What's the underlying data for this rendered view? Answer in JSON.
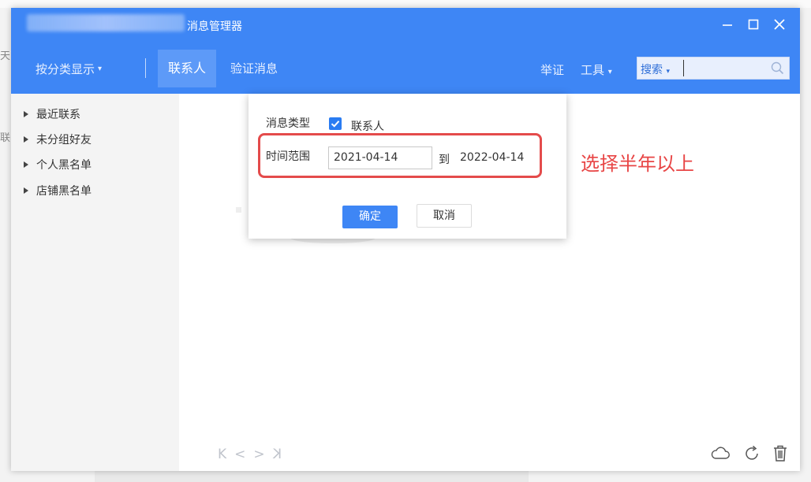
{
  "background": {
    "left_chars": [
      "天",
      "联"
    ]
  },
  "window": {
    "title": "消息管理器",
    "controls": {
      "minimize": "minimize-icon",
      "maximize": "maximize-icon",
      "close": "close-icon"
    }
  },
  "nav": {
    "group_label": "按分类显示",
    "caret": "▾",
    "tabs": [
      {
        "label": "联系人",
        "active": true
      },
      {
        "label": "验证消息",
        "active": false
      }
    ],
    "right_items": [
      "举证",
      "工具"
    ],
    "search": {
      "label": "搜索",
      "caret": "▾",
      "value": ""
    }
  },
  "sidebar": {
    "items": [
      "最近联系",
      "未分组好友",
      "个人黑名单",
      "店铺黑名单"
    ]
  },
  "pager": {
    "first": "K",
    "prev": "<",
    "next": ">",
    "last": "K"
  },
  "dialog": {
    "type_label": "消息类型",
    "type_option": "联系人",
    "type_checked": true,
    "range_label": "时间范围",
    "date_from": "2021-04-14",
    "date_sep": "到",
    "date_to": "2022-04-14",
    "ok_label": "确定",
    "cancel_label": "取消"
  },
  "annotation": {
    "text": "选择半年以上",
    "color": "#e84545"
  },
  "colors": {
    "accent": "#3e86f5",
    "checkbox": "#2a7cf2"
  }
}
